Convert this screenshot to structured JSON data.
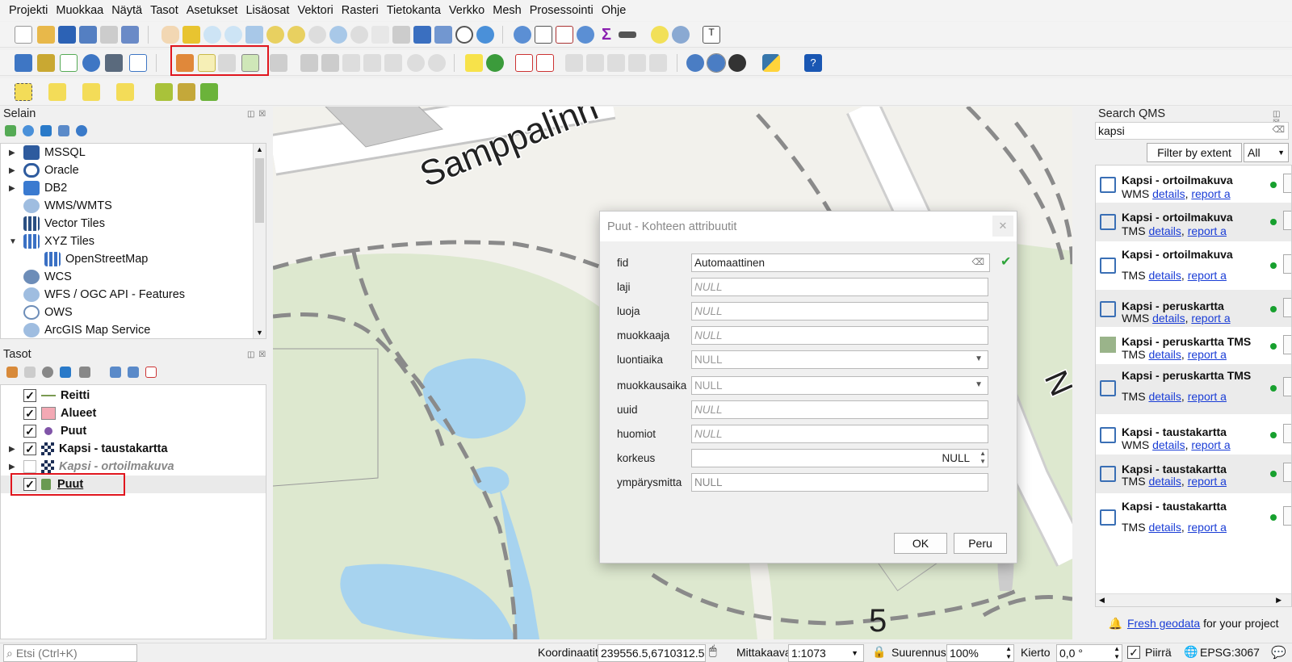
{
  "menubar": {
    "items": [
      "Projekti",
      "Muokkaa",
      "Näytä",
      "Tasot",
      "Asetukset",
      "Lisäosat",
      "Vektori",
      "Rasteri",
      "Tietokanta",
      "Verkko",
      "Mesh",
      "Prosessointi",
      "Ohje"
    ]
  },
  "browser_panel": {
    "title": "Selain",
    "items": [
      {
        "label": "MSSQL",
        "icon": "mssql-icon"
      },
      {
        "label": "Oracle",
        "icon": "oracle-icon"
      },
      {
        "label": "DB2",
        "icon": "db2-icon"
      },
      {
        "label": "WMS/WMTS",
        "icon": "globe-icon"
      },
      {
        "label": "Vector Tiles",
        "icon": "grid-icon"
      },
      {
        "label": "XYZ Tiles",
        "icon": "grid-icon"
      },
      {
        "label": "OpenStreetMap",
        "icon": "grid-icon"
      },
      {
        "label": "WCS",
        "icon": "globe-icon"
      },
      {
        "label": "WFS / OGC API - Features",
        "icon": "globe-icon"
      },
      {
        "label": "OWS",
        "icon": "globe-icon"
      },
      {
        "label": "ArcGIS Map Service",
        "icon": "globe-icon"
      }
    ]
  },
  "layers_panel": {
    "title": "Tasot",
    "layers": [
      {
        "label": "Reitti",
        "checked": true
      },
      {
        "label": "Alueet",
        "checked": true
      },
      {
        "label": "Puut",
        "checked": true
      },
      {
        "label": "Kapsi - taustakartta",
        "checked": true
      },
      {
        "label": "Kapsi - ortoilmakuva",
        "checked": false
      },
      {
        "label": "Puut",
        "checked": true
      }
    ]
  },
  "map": {
    "street_label": "Samppalinn",
    "number_label": "5",
    "edge_letter": "N"
  },
  "dialog": {
    "title": "Puut - Kohteen attribuutit",
    "fields": [
      {
        "label": "fid",
        "value": "Automaattinen"
      },
      {
        "label": "laji",
        "value": "NULL"
      },
      {
        "label": "luoja",
        "value": "NULL"
      },
      {
        "label": "muokkaaja",
        "value": "NULL"
      },
      {
        "label": "luontiaika",
        "value": "NULL"
      },
      {
        "label": "muokkausaika",
        "value": "NULL"
      },
      {
        "label": "uuid",
        "value": "NULL"
      },
      {
        "label": "huomiot",
        "value": "NULL"
      },
      {
        "label": "korkeus",
        "value": "NULL"
      },
      {
        "label": "ympärysmitta",
        "value": "NULL"
      }
    ],
    "ok_label": "OK",
    "cancel_label": "Peru"
  },
  "qms_panel": {
    "title": "Search QMS",
    "search_value": "kapsi",
    "filter_button": "Filter by extent",
    "filter_select": "All",
    "details_label": "details",
    "report_label": "report a",
    "items": [
      {
        "title": "Kapsi - ortoilmakuva",
        "type": "WMS"
      },
      {
        "title": "Kapsi - ortoilmakuva",
        "type": "TMS"
      },
      {
        "title": "Kapsi - ortoilmakuva",
        "type": "TMS"
      },
      {
        "title": "Kapsi - peruskartta",
        "type": "WMS"
      },
      {
        "title": "Kapsi - peruskartta TMS",
        "type": "TMS"
      },
      {
        "title": "Kapsi - peruskartta TMS",
        "type": "TMS"
      },
      {
        "title": "Kapsi - taustakartta",
        "type": "WMS"
      },
      {
        "title": "Kapsi - taustakartta",
        "type": "TMS"
      },
      {
        "title": "Kapsi - taustakartta",
        "type": "TMS"
      }
    ],
    "footer_link": "Fresh geodata",
    "footer_text": " for your project"
  },
  "statusbar": {
    "search_placeholder": "Etsi (Ctrl+K)",
    "coord_label": "Koordinaatit",
    "coord_value": "239556.5,6710312.5",
    "scale_label": "Mittakaava",
    "scale_value": "1:1073",
    "magnifier_label": "Suurennus",
    "magnifier_value": "100%",
    "rotation_label": "Kierto",
    "rotation_value": "0,0 °",
    "render_label": "Piirrä",
    "crs_label": "EPSG:3067"
  },
  "colors": {
    "highlight_red": "#e0161e",
    "link_blue": "#1a3dd6",
    "status_green": "#17a02e"
  }
}
